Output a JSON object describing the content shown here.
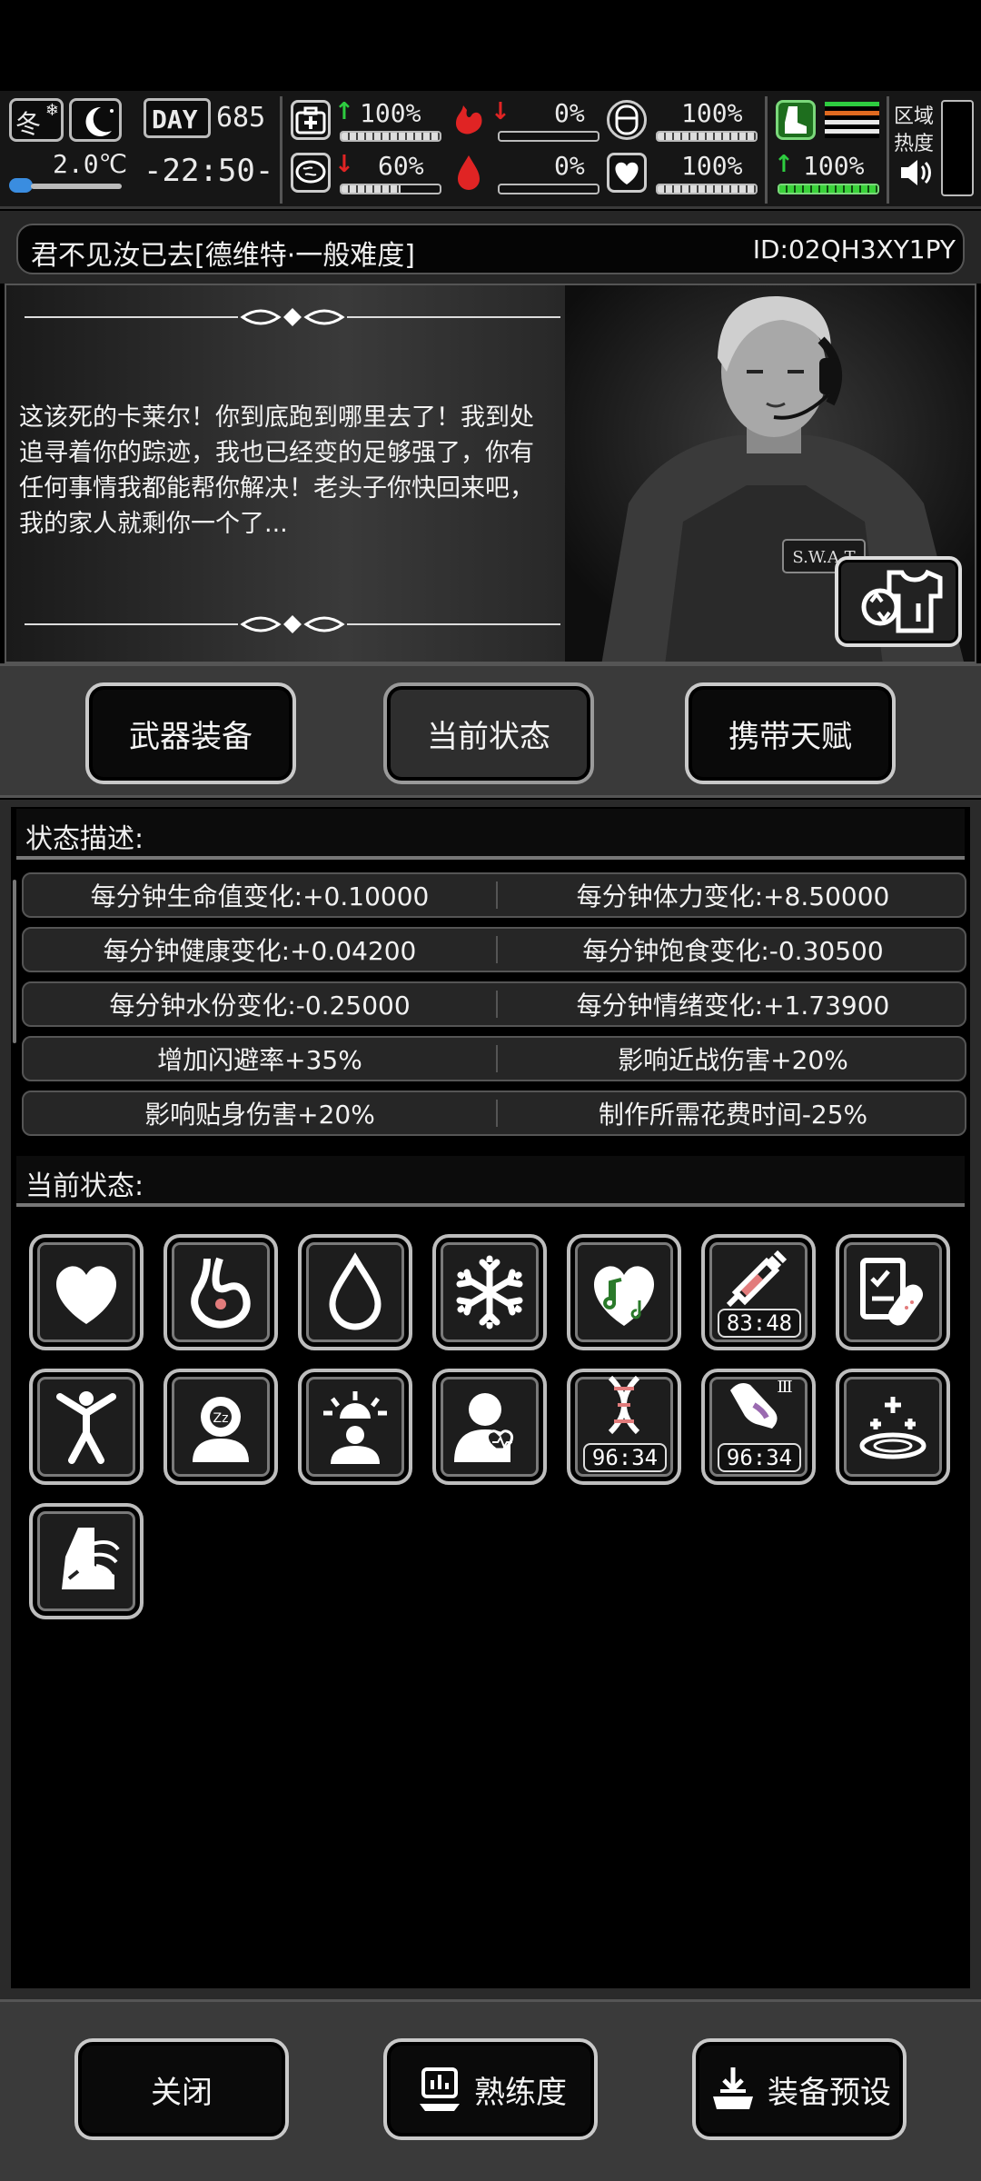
{
  "hud": {
    "season": "冬",
    "temperature": "2.0℃",
    "day_label": "DAY",
    "day_number": "685",
    "time": "-22:50-",
    "stats": [
      {
        "name": "health",
        "value": "100%",
        "trend": "up",
        "level": 1.0
      },
      {
        "name": "stomach",
        "value": "0%",
        "trend": "down",
        "level": 0.0
      },
      {
        "name": "armor",
        "value": "100%",
        "trend": "none",
        "level": 1.0
      },
      {
        "name": "brain",
        "value": "60%",
        "trend": "down",
        "level": 0.6
      },
      {
        "name": "water",
        "value": "0%",
        "trend": "none",
        "level": 0.0
      },
      {
        "name": "heart",
        "value": "100%",
        "trend": "none",
        "level": 1.0
      },
      {
        "name": "stamina",
        "value": "100%",
        "trend": "up",
        "level": 1.0
      }
    ],
    "area_heat_label_1": "区域",
    "area_heat_label_2": "热度",
    "colors": {
      "up": "#2ecc40",
      "down": "#e02424",
      "stamina_bar": "#3ad33a"
    }
  },
  "title": {
    "name": "君不见汝已去[德维特·一般难度]",
    "id": "ID:02QH3XY1PY"
  },
  "story": {
    "text": "这该死的卡莱尔！你到底跑到哪里去了！我到处追寻着你的踪迹，我也已经变的足够强了，你有任何事情我都能帮你解决！老头子你快回来吧，我的家人就剩你一个了...",
    "badge": "S.W.A.T"
  },
  "tabs": [
    {
      "label": "武器装备",
      "active": false
    },
    {
      "label": "当前状态",
      "active": true
    },
    {
      "label": "携带天赋",
      "active": false
    }
  ],
  "status_desc": {
    "heading": "状态描述:",
    "rows": [
      [
        "每分钟生命值变化:+0.10000",
        "每分钟体力变化:+8.50000"
      ],
      [
        "每分钟健康变化:+0.04200",
        "每分钟饱食变化:-0.30500"
      ],
      [
        "每分钟水份变化:-0.25000",
        "每分钟情绪变化:+1.73900"
      ],
      [
        "增加闪避率+35%",
        "影响近战伤害+20%"
      ],
      [
        "影响贴身伤害+20%",
        "制作所需花费时间-25%"
      ]
    ]
  },
  "current_status": {
    "heading": "当前状态:",
    "icons": [
      {
        "icon": "heart-icon"
      },
      {
        "icon": "stomach-icon"
      },
      {
        "icon": "water-drop-icon"
      },
      {
        "icon": "snowflake-icon"
      },
      {
        "icon": "music-heart-icon"
      },
      {
        "icon": "syringe-icon",
        "timer": "83:48"
      },
      {
        "icon": "medical-clipboard-icon"
      },
      {
        "icon": "stretch-person-icon"
      },
      {
        "icon": "sleepy-head-icon"
      },
      {
        "icon": "alarm-person-icon"
      },
      {
        "icon": "heartbeat-person-icon"
      },
      {
        "icon": "dna-icon",
        "timer": "96:34"
      },
      {
        "icon": "muscle-arm-icon",
        "timer": "96:34"
      },
      {
        "icon": "healing-sparkle-icon"
      },
      {
        "icon": "winged-boot-icon"
      }
    ]
  },
  "bottom": {
    "close": "关闭",
    "proficiency": "熟练度",
    "preset": "装备预设"
  }
}
